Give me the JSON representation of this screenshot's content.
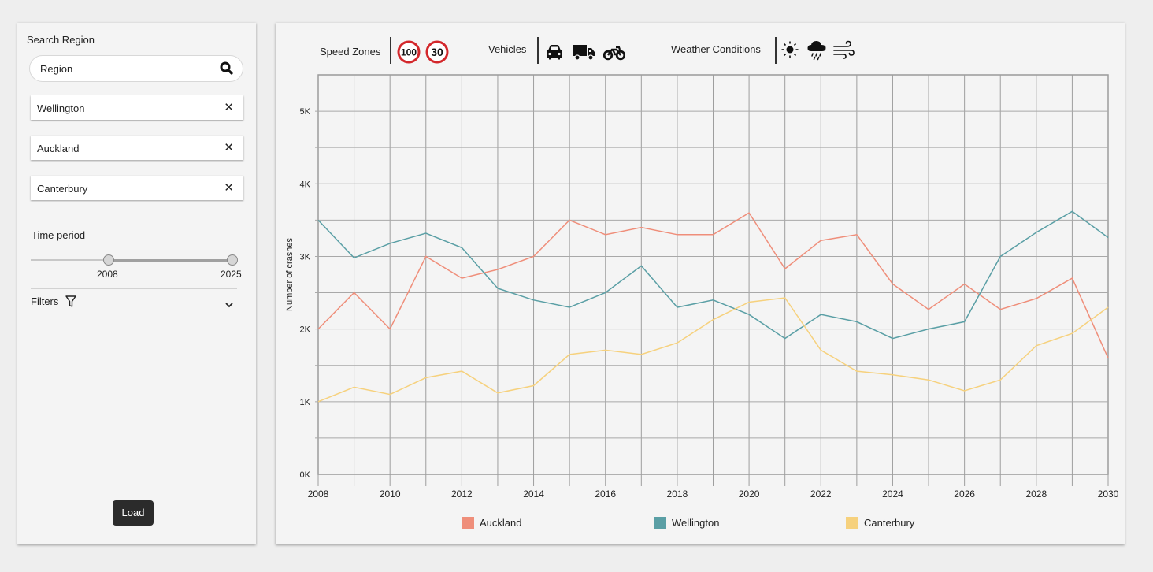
{
  "sidebar": {
    "search_title": "Search Region",
    "search_value": "Region",
    "regions": [
      {
        "label": "Wellington",
        "remove": "✕"
      },
      {
        "label": "Auckland",
        "remove": "✕"
      },
      {
        "label": "Canterbury",
        "remove": "✕"
      }
    ],
    "time_period_label": "Time period",
    "slider": {
      "min": 2008,
      "max": 2025,
      "min_label": "2008",
      "max_label": "2025"
    },
    "filters_label": "Filters",
    "load_label": "Load"
  },
  "toolbar": {
    "speed_label": "Speed Zones",
    "speed_signs": [
      "100",
      "30"
    ],
    "vehicles_label": "Vehicles",
    "vehicle_icons": [
      "car-icon",
      "truck-icon",
      "motorcycle-icon"
    ],
    "weather_label": "Weather Conditions",
    "weather_icons": [
      "sun-icon",
      "rain-cloud-icon",
      "wind-icon"
    ]
  },
  "chart_data": {
    "type": "line",
    "ylabel": "Number of crashes",
    "xlabel": "",
    "xlim": [
      2008,
      2030
    ],
    "ylim": [
      0,
      5500
    ],
    "x_ticks": [
      2008,
      2010,
      2012,
      2014,
      2016,
      2018,
      2020,
      2022,
      2024,
      2026,
      2028,
      2030
    ],
    "y_ticks": [
      0,
      1000,
      2000,
      3000,
      4000,
      5000
    ],
    "y_tick_labels": [
      "0K",
      "1K",
      "2K",
      "3K",
      "4K",
      "5K"
    ],
    "grid": true,
    "legend_position": "bottom",
    "x": [
      2008,
      2009,
      2010,
      2011,
      2012,
      2013,
      2014,
      2015,
      2016,
      2017,
      2018,
      2019,
      2020,
      2021,
      2022,
      2023,
      2024,
      2025,
      2026,
      2027,
      2028,
      2029,
      2030
    ],
    "series": [
      {
        "name": "Auckland",
        "color": "#ef8e7a",
        "values": [
          2000,
          2500,
          2000,
          3000,
          2700,
          2820,
          3000,
          3500,
          3300,
          3400,
          3300,
          3300,
          3600,
          2830,
          3220,
          3300,
          2620,
          2270,
          2620,
          2270,
          2420,
          2700,
          1600
        ]
      },
      {
        "name": "Wellington",
        "color": "#5a9fa5",
        "values": [
          3500,
          2980,
          3180,
          3320,
          3120,
          2560,
          2400,
          2300,
          2500,
          2870,
          2300,
          2400,
          2200,
          1870,
          2200,
          2100,
          1870,
          2000,
          2100,
          3000,
          3330,
          3620,
          3260
        ]
      },
      {
        "name": "Canterbury",
        "color": "#f6d17d",
        "values": [
          1000,
          1200,
          1100,
          1330,
          1420,
          1120,
          1220,
          1650,
          1710,
          1650,
          1810,
          2130,
          2370,
          2430,
          1710,
          1420,
          1370,
          1300,
          1150,
          1300,
          1770,
          1940,
          2300
        ]
      }
    ]
  }
}
